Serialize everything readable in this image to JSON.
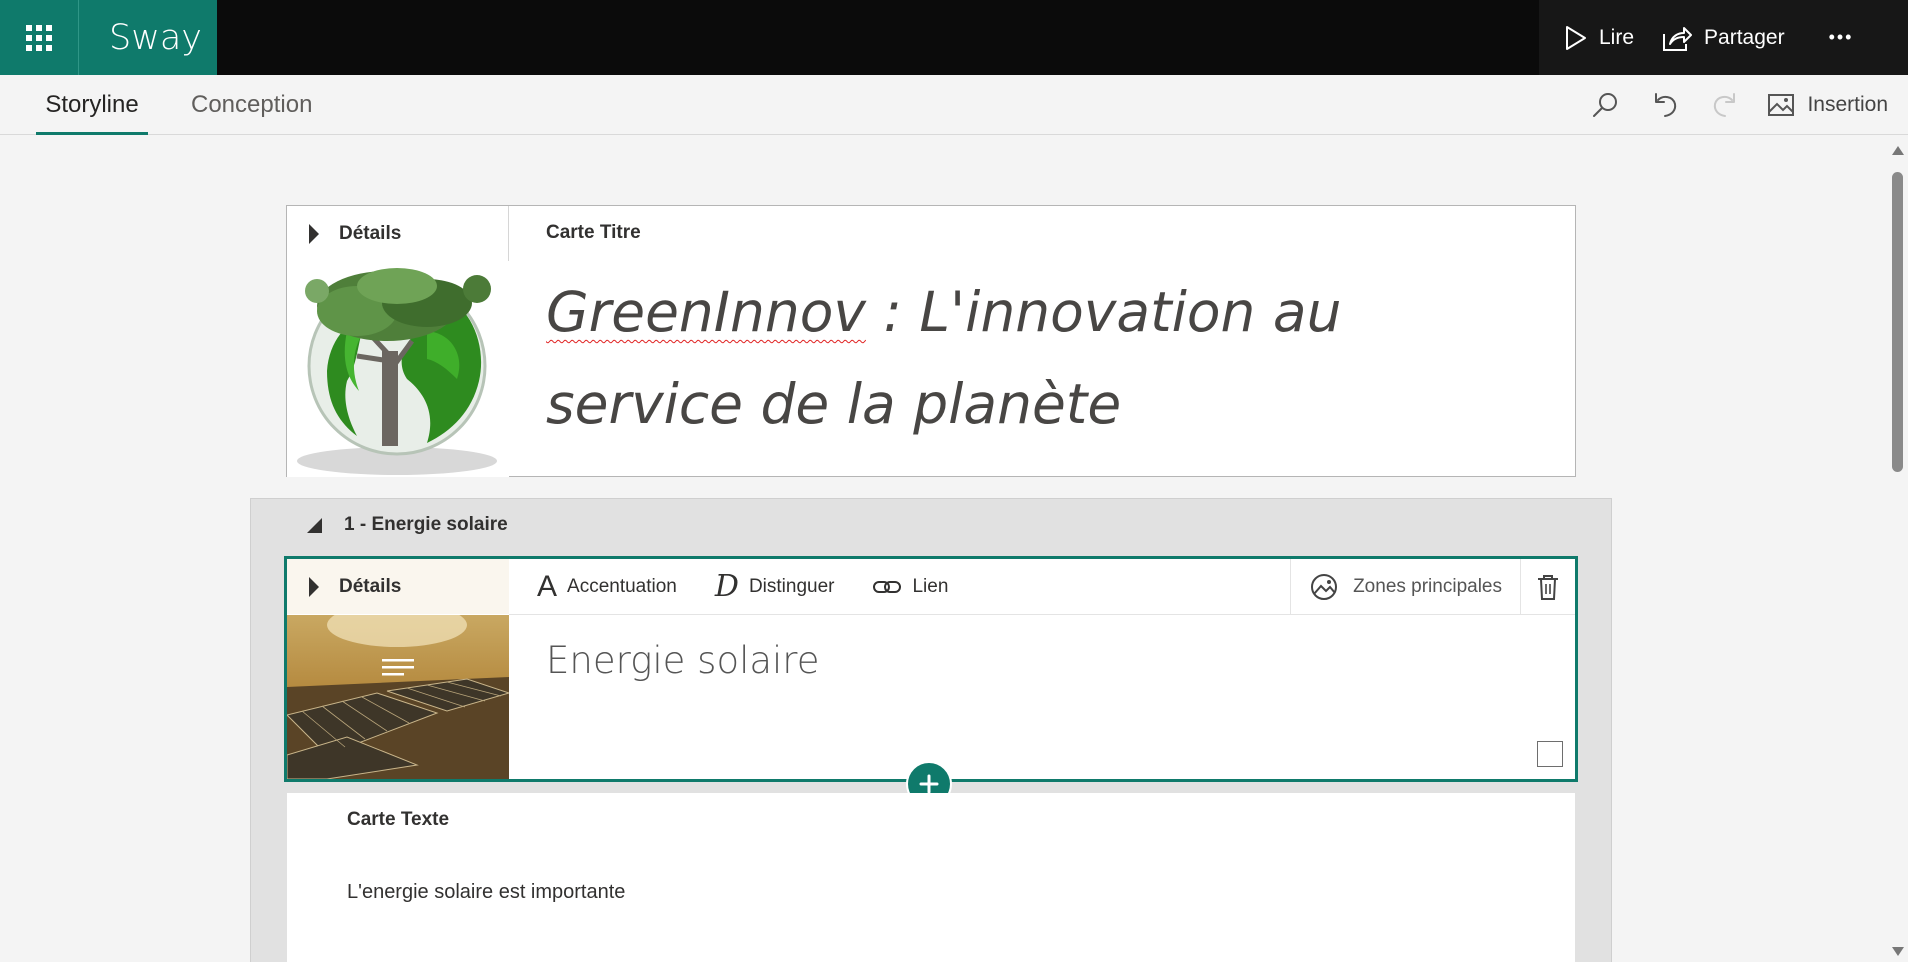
{
  "app": {
    "name": "Sway",
    "brand_color": "#0f7a6b"
  },
  "topbar": {
    "play_label": "Lire",
    "share_label": "Partager",
    "more_label": "•••"
  },
  "ribbon": {
    "tabs": [
      {
        "label": "Storyline",
        "active": true
      },
      {
        "label": "Conception",
        "active": false
      }
    ],
    "insert_label": "Insertion"
  },
  "title_card": {
    "details_label": "Détails",
    "card_type": "Carte Titre",
    "title_misspelled": "GreenInnov",
    "title_rest": " : L'innovation au service de la planète"
  },
  "section": {
    "header": "1 - Energie solaire",
    "heading_card": {
      "details_label": "Détails",
      "toolbar": {
        "emphasis_glyph": "A",
        "emphasis": "Accentuation",
        "distinguish_glyph": "D",
        "distinguish": "Distinguer",
        "link": "Lien",
        "focus_points": "Zones principales"
      },
      "heading": "Energie solaire"
    },
    "text_card": {
      "card_type": "Carte Texte",
      "body": "L'energie solaire est importante"
    }
  }
}
